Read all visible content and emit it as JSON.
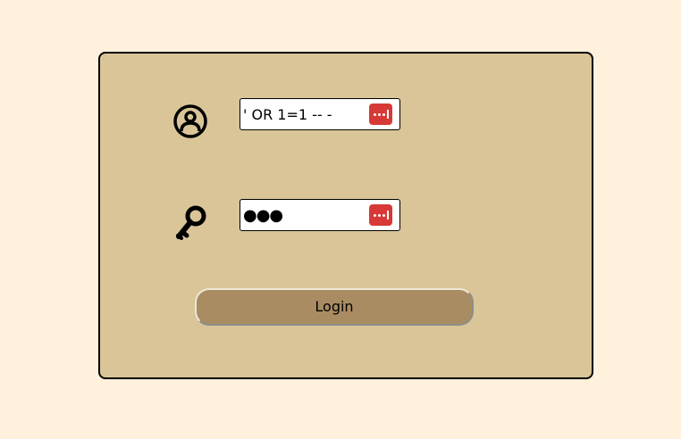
{
  "form": {
    "username": {
      "value": "' OR 1=1 -- -",
      "icon": "user-circle-icon"
    },
    "password": {
      "value": "●●●",
      "icon": "key-icon"
    },
    "password_manager_icon": "password-manager-icon",
    "login_label": "Login"
  },
  "colors": {
    "page_background": "#fff1dc",
    "card_background": "#d9c597",
    "button_background": "#a98c62",
    "password_manager": "#d73a36"
  }
}
